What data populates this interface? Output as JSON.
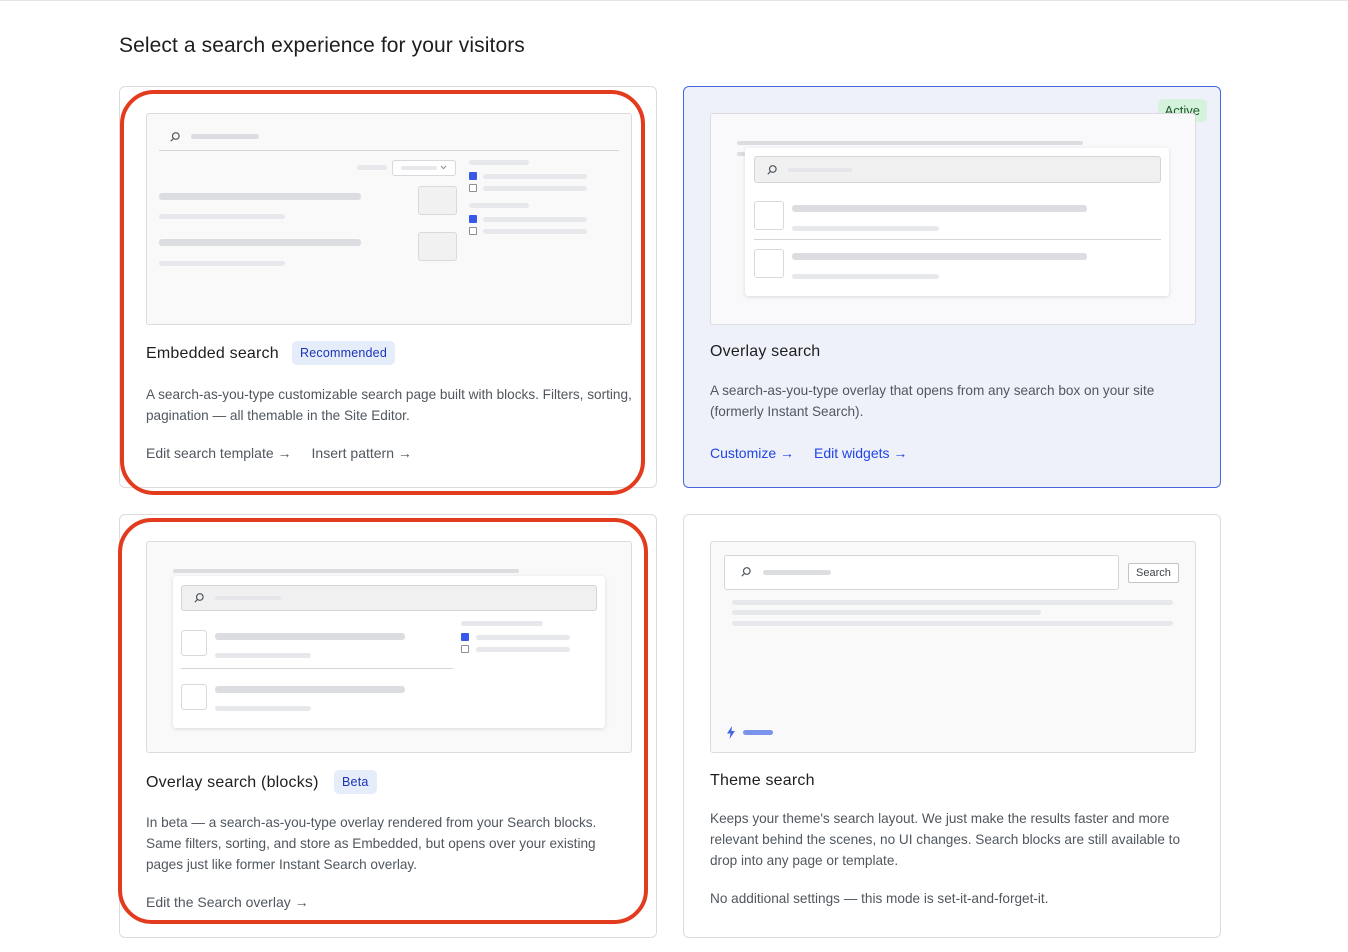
{
  "page": {
    "title": "Select a search experience for your visitors"
  },
  "cards": [
    {
      "title": "Embedded search",
      "badge": "Recommended",
      "description": "A search-as-you-type customizable search page built with blocks. Filters, sorting, pagination — all themable in the Site Editor.",
      "links": [
        "Edit search template →",
        "Insert pattern →"
      ],
      "highlighted": true
    },
    {
      "title": "Overlay search",
      "status": "Active",
      "description": "A search-as-you-type overlay that opens from any search box on your site (formerly Instant Search).",
      "links": [
        "Customize →",
        "Edit widgets →"
      ],
      "active": true
    },
    {
      "title": "Overlay search (blocks)",
      "badge": "Beta",
      "description": "In beta — a search-as-you-type overlay rendered from your Search blocks. Same filters, sorting, and store as Embedded, but opens over your existing pages just like former Instant Search overlay.",
      "links": [
        "Edit the Search overlay →"
      ],
      "highlighted": true
    },
    {
      "title": "Theme search",
      "description": "Keeps your theme's search layout. We just make the results faster and more relevant behind the scenes, no UI changes. Search blocks are still available to drop into any page or template.",
      "note": "No additional settings — this mode is set-it-and-forget-it.",
      "preview_button": "Search"
    }
  ],
  "colors": {
    "accent": "#2145e6",
    "active_border": "#4666e0",
    "active_bg": "#eef1fa",
    "badge_bg": "#e5ecfa",
    "active_badge_bg": "#d4f2dc",
    "highlight": "#e33b1e",
    "checkbox_on": "#3858e9"
  }
}
